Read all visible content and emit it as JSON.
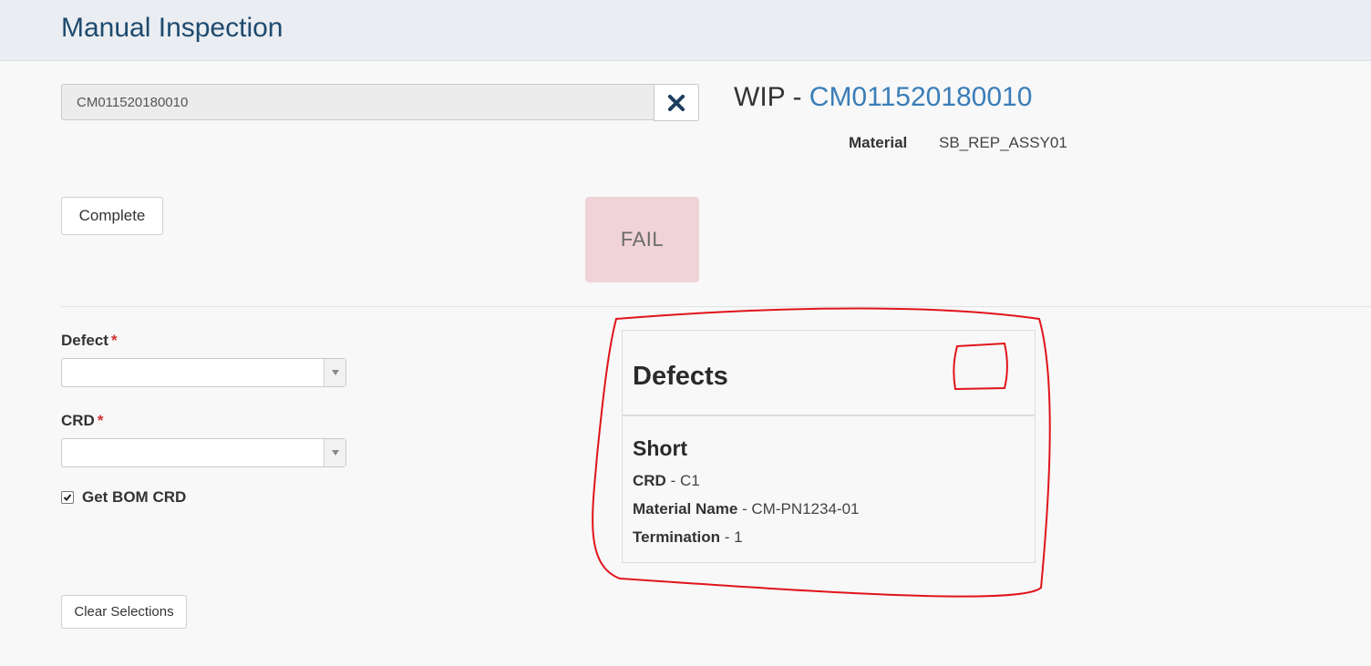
{
  "header": {
    "title": "Manual Inspection"
  },
  "wip_search": {
    "value": "CM011520180010",
    "clear_icon": "close-icon"
  },
  "wip": {
    "prefix": "WIP - ",
    "id": "CM011520180010",
    "material_label": "Material",
    "material_value": "SB_REP_ASSY01"
  },
  "actions": {
    "complete_label": "Complete",
    "clear_label": "Clear Selections"
  },
  "status": {
    "label": "FAIL",
    "color": "#f0d3d8"
  },
  "form": {
    "defect_label": "Defect",
    "crd_label": "CRD",
    "required_mark": "*",
    "defect_value": "",
    "crd_value": "",
    "get_bom_label": "Get BOM CRD",
    "get_bom_checked": true
  },
  "defects_panel": {
    "title": "Defects",
    "items": [
      {
        "type": "Short",
        "crd_label": "CRD",
        "crd_value": "C1",
        "material_label": "Material Name",
        "material_value": "CM-PN1234-01",
        "termination_label": "Termination",
        "termination_value": "1"
      }
    ]
  },
  "separator": " - ",
  "colors": {
    "accent": "#3a7db8",
    "title": "#1d4a6e",
    "required": "#d0302f",
    "annotation": "#e0141a"
  }
}
